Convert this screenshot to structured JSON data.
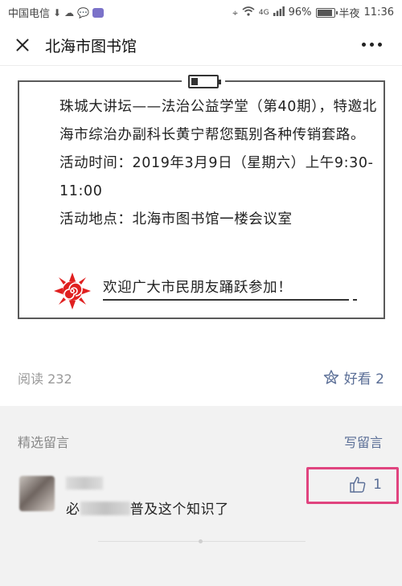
{
  "status_bar": {
    "carrier": "中国电信",
    "battery_percent": "96%",
    "period": "半夜",
    "time": "11:36",
    "network": "4G",
    "battery_level": 0.96
  },
  "header": {
    "title": "北海市图书馆",
    "close_icon": "close-icon",
    "more_icon": "more-icon"
  },
  "article": {
    "paragraph1": "珠城大讲坛——法治公益学堂（第40期），特邀北海市综治办副科长黄宁帮您甄别各种传销套路。",
    "paragraph2": "活动时间：2019年3月9日（星期六）上午9:30-11:00",
    "paragraph3": "活动地点：北海市图书馆一楼会议室",
    "welcome": "欢迎广大市民朋友踊跃参加！"
  },
  "stats": {
    "read_label": "阅读 232",
    "wow_label": "好看 2",
    "accent_color": "#5a6e96"
  },
  "comments": {
    "section_title": "精选留言",
    "write_label": "写留言",
    "items": [
      {
        "text_prefix": "必",
        "text_suffix": "普及这个知识了",
        "likes": "1"
      }
    ],
    "highlight_color": "#e0447f"
  }
}
